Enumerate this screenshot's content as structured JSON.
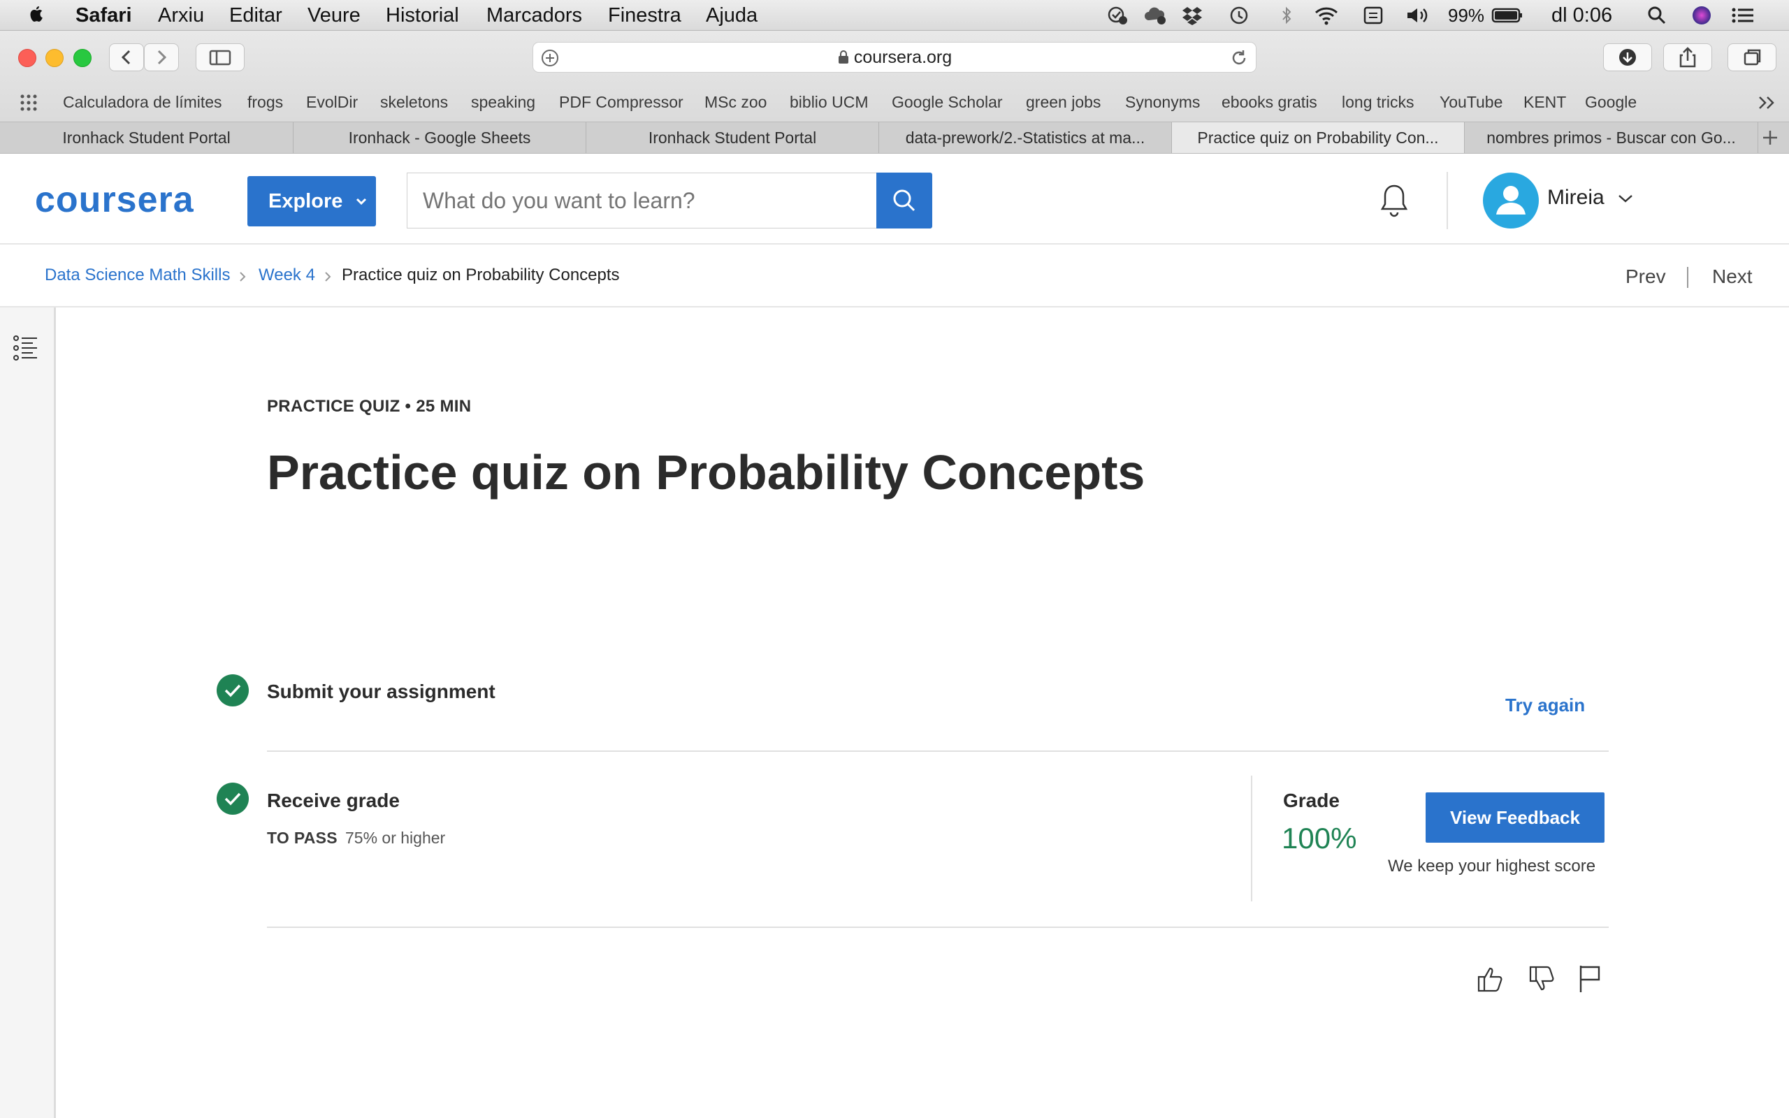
{
  "menubar": {
    "app": "Safari",
    "items": [
      "Arxiu",
      "Editar",
      "Veure",
      "Historial",
      "Marcadors",
      "Finestra",
      "Ajuda"
    ],
    "battery": "99%",
    "clock": "dl 0:06"
  },
  "browser": {
    "url": "coursera.org",
    "bookmarks": [
      "Calculadora de límites",
      "frogs",
      "EvolDir",
      "skeletons",
      "speaking",
      "PDF Compressor",
      "MSc zoo",
      "biblio UCM",
      "Google Scholar",
      "green jobs",
      "Synonyms",
      "ebooks gratis",
      "long tricks",
      "YouTube",
      "KENT",
      "Google"
    ],
    "tabs": [
      "Ironhack Student Portal",
      "Ironhack - Google Sheets",
      "Ironhack Student Portal",
      "data-prework/2.-Statistics at ma...",
      "Practice quiz on Probability Con...",
      "nombres primos - Buscar con Go..."
    ],
    "active_tab": 4
  },
  "header": {
    "logo": "coursera",
    "explore": "Explore",
    "search_placeholder": "What do you want to learn?",
    "user": "Mireia"
  },
  "breadcrumb": {
    "course": "Data Science Math Skills",
    "week": "Week 4",
    "current": "Practice quiz on Probability Concepts",
    "prev": "Prev",
    "next": "Next"
  },
  "quiz": {
    "eyebrow": "PRACTICE QUIZ • 25 MIN",
    "title": "Practice quiz on Probability Concepts",
    "submit_label": "Submit your assignment",
    "try_again": "Try again",
    "receive_label": "Receive grade",
    "to_pass_label": "TO PASS",
    "to_pass_value": "75% or higher",
    "grade_label": "Grade",
    "grade_value": "100%",
    "view_feedback": "View Feedback",
    "highest_note": "We keep your highest score"
  },
  "colors": {
    "brand_blue": "#2a73cc",
    "success_green": "#1f8354"
  }
}
